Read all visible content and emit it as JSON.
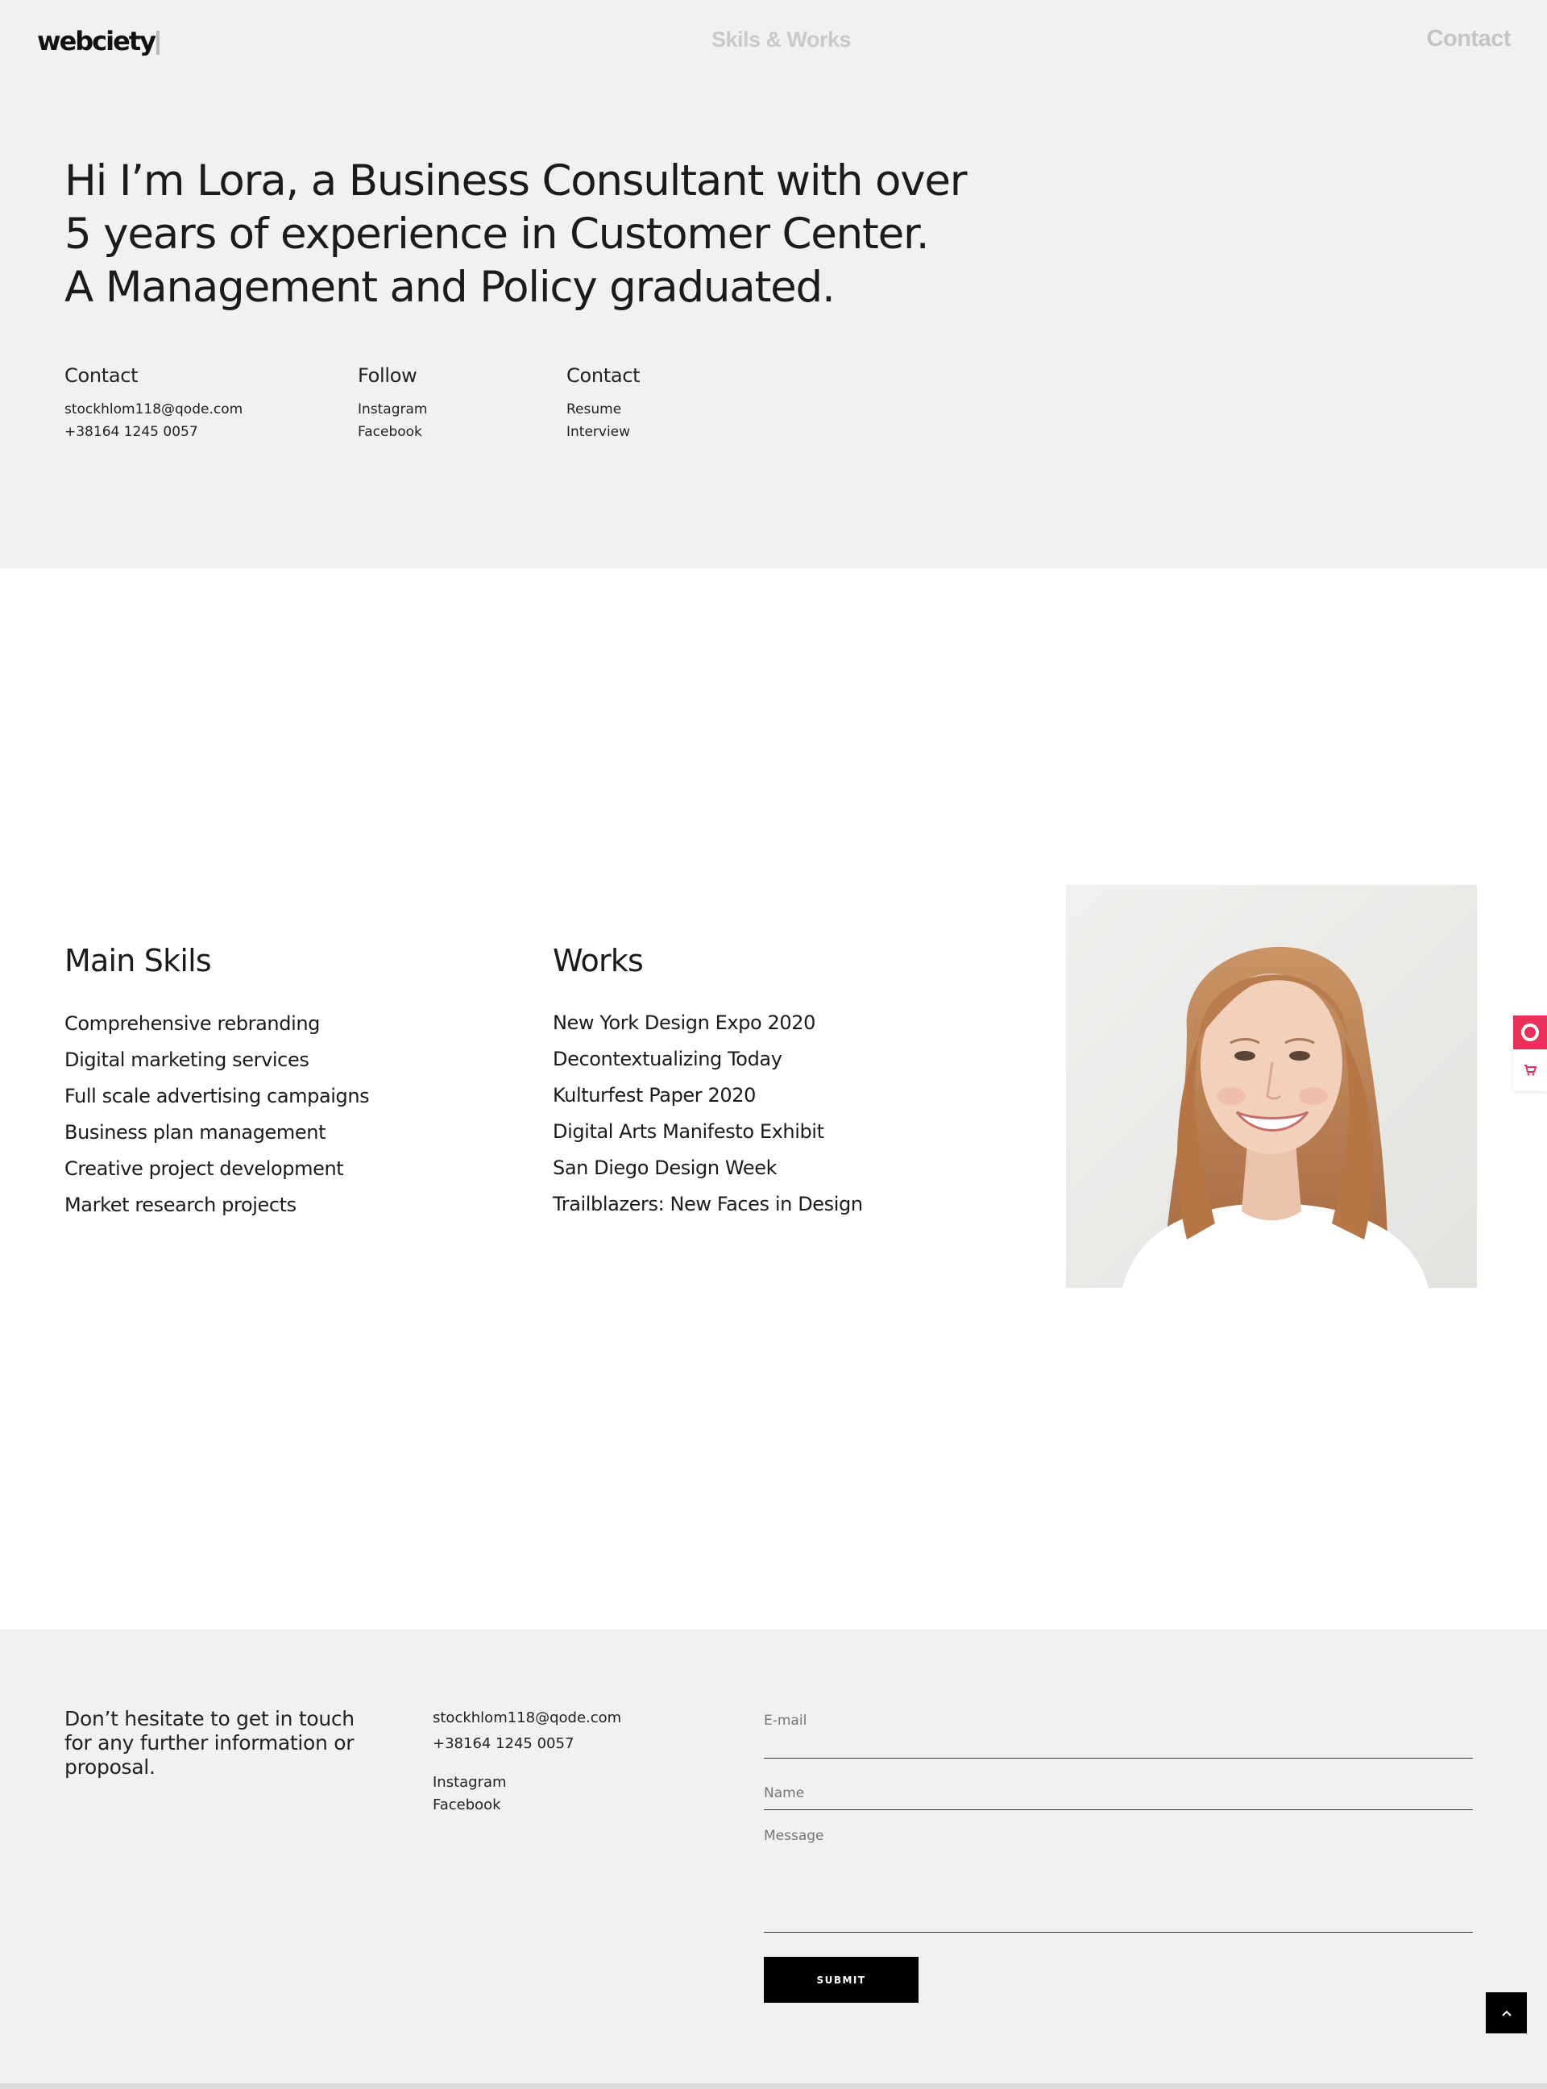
{
  "header": {
    "logo": "webciety",
    "nav_center": "Skils & Works",
    "nav_right": "Contact"
  },
  "hero": {
    "lines": [
      "Hi  I’m  Lora, a  Business Consultant with over",
      "5 years of experience in Customer Center.",
      "A  Management and  Policy graduated."
    ],
    "columns": [
      {
        "title": "Contact",
        "items": [
          "stockhlom118@qode.com",
          "+38164 1245 0057"
        ]
      },
      {
        "title": "Follow",
        "items": [
          "Instagram",
          "Facebook"
        ]
      },
      {
        "title": "Contact",
        "items": [
          "Resume",
          "Interview"
        ]
      }
    ]
  },
  "skills": {
    "title": "Main Skils",
    "items": [
      "Comprehensive rebranding",
      "Digital marketing services",
      "Full scale advertising campaigns",
      "Business plan management",
      "Creative project development",
      "Market research projects"
    ]
  },
  "works": {
    "title": "Works",
    "items": [
      "New York Design Expo 2020",
      "Decontextualizing Today",
      "Kulturfest Paper 2020",
      "Digital Arts Manifesto Exhibit",
      "San Diego Design Week",
      "Trailblazers: New Faces in Design"
    ]
  },
  "side_widget": {
    "top_icon": "lifebuoy-icon",
    "bottom_icon": "cart-icon",
    "accent": "#e8305a"
  },
  "footer": {
    "tagline": "Don’t hesitate to get in touch for any further information or proposal.",
    "email": "stockhlom118@qode.com",
    "phone": "+38164 1245 0057",
    "social": [
      "Instagram",
      "Facebook"
    ],
    "form": {
      "email_placeholder": "E-mail",
      "name_placeholder": "Name",
      "message_placeholder": "Message",
      "submit_label": "SUBMIT"
    },
    "back_to_top_icon": "chevron-up-icon"
  }
}
